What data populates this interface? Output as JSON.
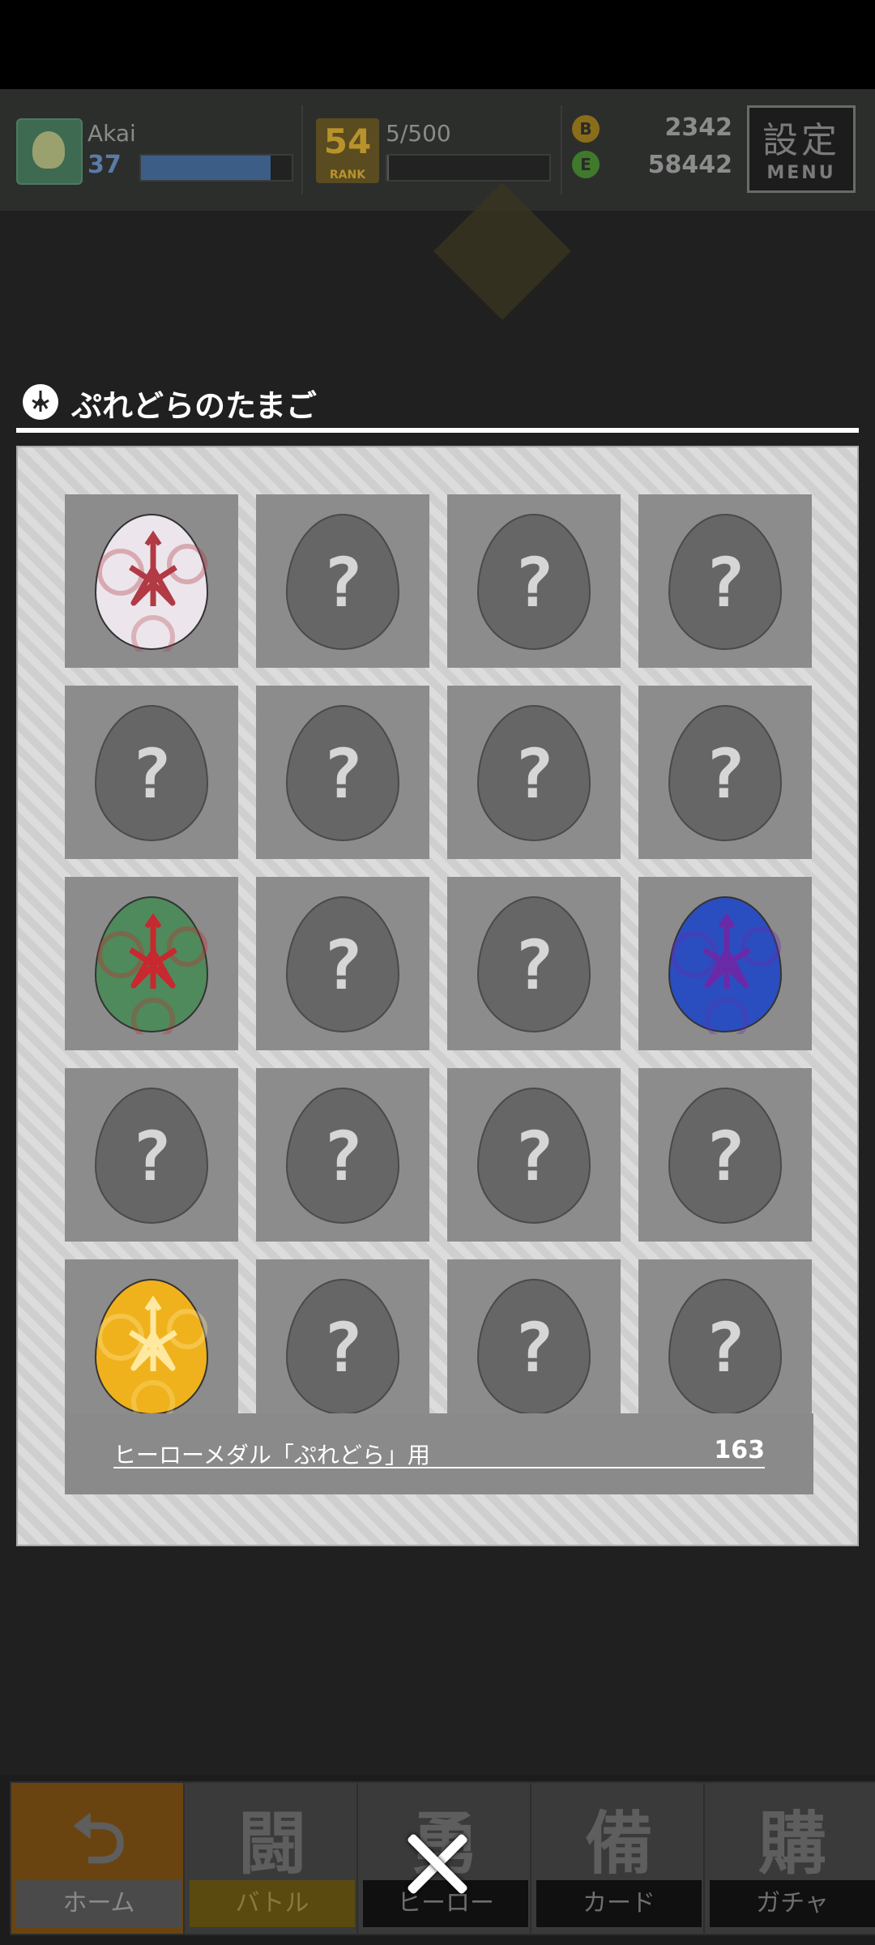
{
  "hud": {
    "player_name": "Akai",
    "level": "37",
    "level_progress": 0.86,
    "rank": "54",
    "rank_label": "RANK",
    "stamina": "5/500",
    "stamina_progress": 0.01,
    "gold_icon_glyph": "B",
    "gold": "2342",
    "gem_icon_glyph": "E",
    "gems": "58442",
    "settings_kanji": "設定",
    "settings_sub": "MENU"
  },
  "dialog": {
    "title": "ぷれどらのたまご",
    "unknown_mark": "?",
    "eggs": [
      {
        "state": "collected",
        "color": "white"
      },
      {
        "state": "unknown"
      },
      {
        "state": "unknown"
      },
      {
        "state": "unknown"
      },
      {
        "state": "unknown"
      },
      {
        "state": "unknown"
      },
      {
        "state": "unknown"
      },
      {
        "state": "unknown"
      },
      {
        "state": "collected",
        "color": "green"
      },
      {
        "state": "unknown"
      },
      {
        "state": "unknown"
      },
      {
        "state": "collected",
        "color": "blue"
      },
      {
        "state": "unknown"
      },
      {
        "state": "unknown"
      },
      {
        "state": "unknown"
      },
      {
        "state": "unknown"
      },
      {
        "state": "collected",
        "color": "yellow"
      },
      {
        "state": "unknown"
      },
      {
        "state": "unknown"
      },
      {
        "state": "unknown"
      }
    ],
    "medal_label": "ヒーローメダル「ぷれどら」用",
    "medal_count": "163"
  },
  "egg_colors": {
    "white": {
      "base": "#ece6ec",
      "mark": "#b13a45"
    },
    "green": {
      "base": "#4f8a5c",
      "mark": "#c8282f"
    },
    "blue": {
      "base": "#2a4ec0",
      "mark": "#6a2aa8"
    },
    "yellow": {
      "base": "#f0b21c",
      "mark": "#ffe9a0"
    }
  },
  "nav": [
    {
      "icon": "⮌",
      "label": "ホーム",
      "name": "home"
    },
    {
      "icon": "闘",
      "label": "バトル",
      "name": "battle"
    },
    {
      "icon": "勇",
      "label": "ヒーロー",
      "name": "hero"
    },
    {
      "icon": "備",
      "label": "カード",
      "name": "card"
    },
    {
      "icon": "購",
      "label": "ガチャ",
      "name": "gacha"
    }
  ],
  "colors": {
    "accent": "#ffffff",
    "overlay": "#202020"
  }
}
